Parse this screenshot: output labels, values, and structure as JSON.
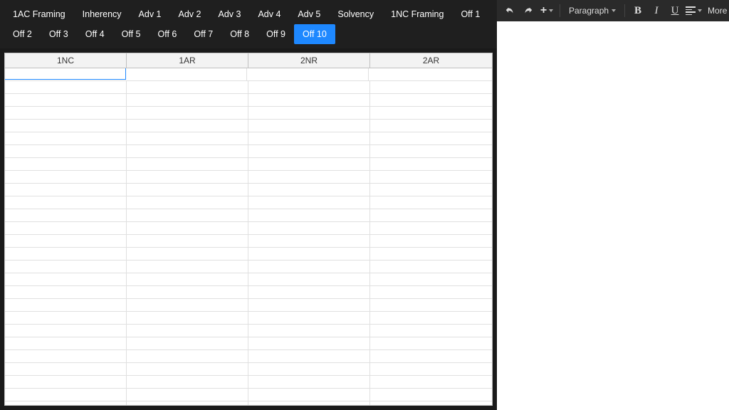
{
  "tabs": [
    {
      "label": "1AC Framing",
      "active": false
    },
    {
      "label": "Inherency",
      "active": false
    },
    {
      "label": "Adv 1",
      "active": false
    },
    {
      "label": "Adv 2",
      "active": false
    },
    {
      "label": "Adv 3",
      "active": false
    },
    {
      "label": "Adv 4",
      "active": false
    },
    {
      "label": "Adv 5",
      "active": false
    },
    {
      "label": "Solvency",
      "active": false
    },
    {
      "label": "1NC Framing",
      "active": false
    },
    {
      "label": "Off 1",
      "active": false
    },
    {
      "label": "Off 2",
      "active": false
    },
    {
      "label": "Off 3",
      "active": false
    },
    {
      "label": "Off 4",
      "active": false
    },
    {
      "label": "Off 5",
      "active": false
    },
    {
      "label": "Off 6",
      "active": false
    },
    {
      "label": "Off 7",
      "active": false
    },
    {
      "label": "Off 8",
      "active": false
    },
    {
      "label": "Off 9",
      "active": false
    },
    {
      "label": "Off 10",
      "active": true
    }
  ],
  "grid": {
    "columns": [
      "1NC",
      "1AR",
      "2NR",
      "2AR"
    ],
    "rows": 27,
    "selected": {
      "row": 0,
      "col": 0
    }
  },
  "toolbar": {
    "paragraph_label": "Paragraph",
    "more_label": "More",
    "bold": "B",
    "italic": "I",
    "underline": "U"
  }
}
